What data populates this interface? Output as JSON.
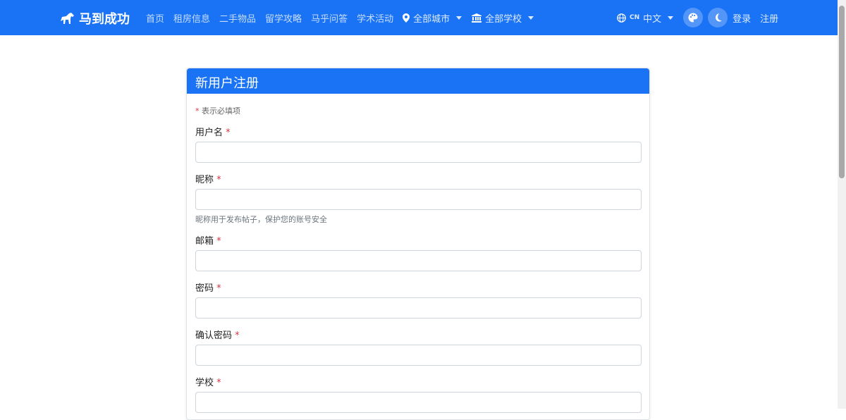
{
  "nav": {
    "brand": "马到成功",
    "links": [
      "首页",
      "租房信息",
      "二手物品",
      "留学攻略",
      "马乎问答",
      "学术活动"
    ],
    "city_dropdown": "全部城市",
    "school_dropdown": "全部学校",
    "lang_code": "CN",
    "lang_label": "中文",
    "login": "登录",
    "register": "注册"
  },
  "form": {
    "title": "新用户注册",
    "required_note_star": "*",
    "required_note": "表示必填项",
    "fields": [
      {
        "label": "用户名",
        "help": ""
      },
      {
        "label": "昵称",
        "help": "昵称用于发布帖子，保护您的账号安全"
      },
      {
        "label": "邮箱",
        "help": ""
      },
      {
        "label": "密码",
        "help": ""
      },
      {
        "label": "确认密码",
        "help": ""
      },
      {
        "label": "学校",
        "help": ""
      }
    ],
    "star": "*"
  },
  "colors": {
    "primary": "#1a73f5",
    "required": "#dc3545"
  }
}
